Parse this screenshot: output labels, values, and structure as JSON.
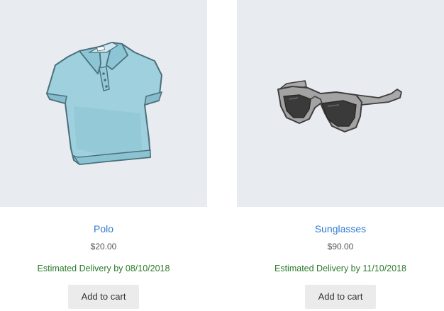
{
  "products": [
    {
      "name": "Polo",
      "price": "$20.00",
      "delivery": "Estimated Delivery by 08/10/2018",
      "button_label": "Add to cart",
      "image_icon": "polo-shirt-image"
    },
    {
      "name": "Sunglasses",
      "price": "$90.00",
      "delivery": "Estimated Delivery by 11/10/2018",
      "button_label": "Add to cart",
      "image_icon": "sunglasses-image"
    }
  ],
  "colors": {
    "thumb_bg": "#e8ecf1",
    "title_link": "#2f7bd1",
    "delivery_text": "#2b7a2b",
    "button_bg": "#ebebeb"
  }
}
